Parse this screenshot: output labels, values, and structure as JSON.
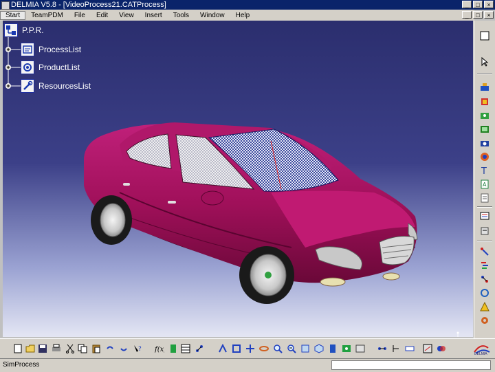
{
  "window": {
    "title": "DELMIA V5.8 - [VideoProcess21.CATProcess]",
    "buttons": [
      "_",
      "□",
      "×"
    ]
  },
  "menubar": {
    "items": [
      "Start",
      "TeamPDM",
      "File",
      "Edit",
      "View",
      "Insert",
      "Tools",
      "Window",
      "Help"
    ],
    "active_index": 0
  },
  "tree": {
    "root": "P.P.R.",
    "children": [
      "ProcessList",
      "ProductList",
      "ResourcesList"
    ]
  },
  "status": {
    "text": "SimProcess",
    "command_value": ""
  },
  "logo": {
    "text": "DELMIA"
  },
  "colors": {
    "car_body": "#a0105a",
    "car_body_dark": "#5e0832",
    "glass": "#4a5aa8",
    "tree_text": "#ffffff",
    "ui_face": "#d4d0c8"
  },
  "right_toolbar_icons": [
    "select-arrow-icon",
    "crane-icon",
    "robot-icon",
    "fasten-icon",
    "part-library-icon",
    "camera-icon",
    "simulation-icon",
    "text-icon",
    "annotation-icon",
    "doc-icon",
    "list-icon",
    "sequence-icon",
    "link-icon",
    "gantt-icon",
    "rotate-icon",
    "warning-icon",
    "gear-icon"
  ],
  "bottom_toolbar_icons": [
    "new-icon",
    "open-icon",
    "save-icon",
    "print-icon",
    "cut-icon",
    "copy-icon",
    "paste-icon",
    "undo-icon",
    "redo-icon",
    "help-icon",
    "formula-icon",
    "catalog-icon",
    "table-icon",
    "graph-icon",
    "fly-icon",
    "fit-all-icon",
    "pan-icon",
    "rotate-view-icon",
    "zoom-in-icon",
    "zoom-out-icon",
    "normal-view-icon",
    "iso-view-icon",
    "shading-icon",
    "hide-show-icon",
    "swap-visible-icon",
    "network-icon",
    "tree-icon",
    "measure-icon",
    "analyze-icon",
    "clash-icon"
  ]
}
